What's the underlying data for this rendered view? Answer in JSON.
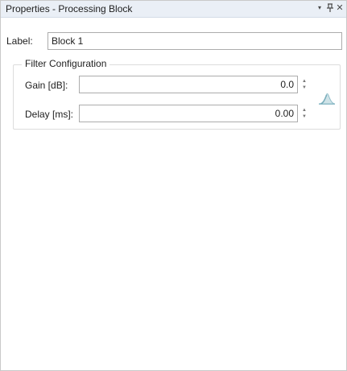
{
  "panel": {
    "title": "Properties - Processing Block",
    "dropdown_icon": "▾",
    "pin_icon": "ᵽ",
    "close_icon": "✕"
  },
  "label_field": {
    "caption": "Label:",
    "value": "Block 1"
  },
  "filter_group": {
    "legend": "Filter Configuration",
    "gain": {
      "caption": "Gain [dB]:",
      "value": "0.0"
    },
    "delay": {
      "caption": "Delay [ms]:",
      "value": "0.00"
    },
    "icon": "waveform-icon",
    "icon_color": "#8fbcc8"
  }
}
